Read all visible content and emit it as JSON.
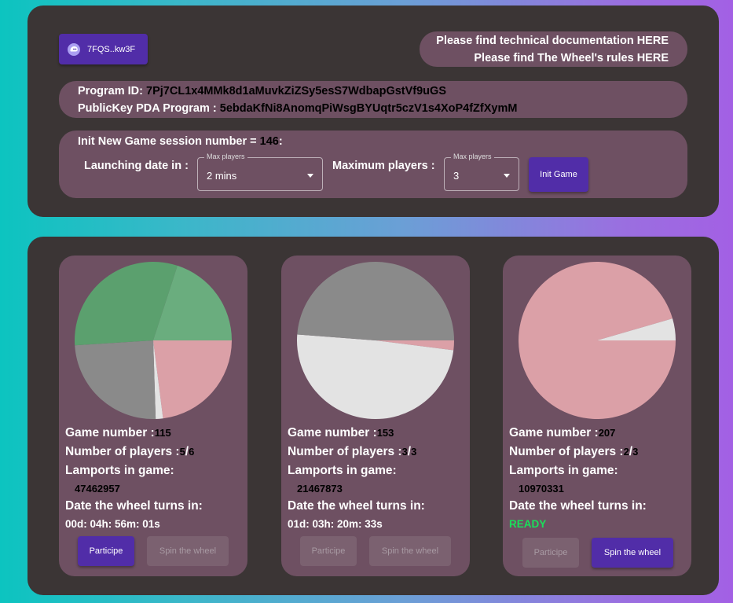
{
  "wallet": {
    "label": "7FQS..kw3F"
  },
  "links": {
    "docs": "Please find technical documentation HERE",
    "rules": "Please find The Wheel's rules HERE"
  },
  "program": {
    "id_label": "Program ID:",
    "id_value": "7Pj7CL1x4MMk8d1aMuvkZiZSy5esS7WdbapGstVf9uGS",
    "pda_label": "PublicKey PDA Program :",
    "pda_value": "5ebdaKfNi8AnomqPiWsgBYUqtr5czV1s4XoP4fZfXymM"
  },
  "init": {
    "title_prefix": "Init New Game session number =",
    "session_number": "146",
    "title_suffix": ":",
    "launch_label": "Launching date in :",
    "launch_legend": "Max players",
    "launch_value": "2 mins",
    "max_label": "Maximum players :",
    "max_legend": "Max players",
    "max_value": "3",
    "button": "Init Game"
  },
  "games": [
    {
      "game_label": "Game number :",
      "game_number": "115",
      "players_label": "Number of players :",
      "players_current": "5",
      "players_sep": "/",
      "players_max": "6",
      "lamports_label": "Lamports in game:",
      "lamports": "47462957",
      "date_label": "Date the wheel turns in:",
      "timer": "00d: 04h: 56m: 01s",
      "participe": "Participe",
      "spin": "Spin the wheel",
      "participe_enabled": true,
      "spin_enabled": false,
      "slices": [
        {
          "value": 0.23,
          "color": "#dba0a7"
        },
        {
          "value": 0.015,
          "color": "#e3e3e3"
        },
        {
          "value": 0.245,
          "color": "#8a8a8a"
        },
        {
          "value": 0.31,
          "color": "#5ba06e"
        },
        {
          "value": 0.2,
          "color": "#6aad7e"
        }
      ]
    },
    {
      "game_label": "Game number :",
      "game_number": "153",
      "players_label": "Number of players :",
      "players_current": "3",
      "players_sep": "/",
      "players_max": "3",
      "lamports_label": "Lamports in game:",
      "lamports": "21467873",
      "date_label": "Date the wheel turns in:",
      "timer": "01d: 03h: 20m: 33s",
      "participe": "Participe",
      "spin": "Spin the wheel",
      "participe_enabled": false,
      "spin_enabled": false,
      "slices": [
        {
          "value": 0.02,
          "color": "#dba0a7"
        },
        {
          "value": 0.492,
          "color": "#e3e3e3"
        },
        {
          "value": 0.488,
          "color": "#8a8a8a"
        }
      ]
    },
    {
      "game_label": "Game number :",
      "game_number": "207",
      "players_label": "Number of players :",
      "players_current": "2",
      "players_sep": "/",
      "players_max": "3",
      "lamports_label": "Lamports in game:",
      "lamports": "10970331",
      "date_label": "Date the wheel turns in:",
      "timer": "READY",
      "participe": "Participe",
      "spin": "Spin the wheel",
      "participe_enabled": false,
      "spin_enabled": true,
      "slices": [
        {
          "value": 0.955,
          "color": "#dba0a7"
        },
        {
          "value": 0.045,
          "color": "#e3e3e3"
        }
      ]
    }
  ],
  "colors": {
    "panel": "#3b3535",
    "pill": "#6e5062",
    "button": "#512da8",
    "ready": "#19e05a"
  }
}
